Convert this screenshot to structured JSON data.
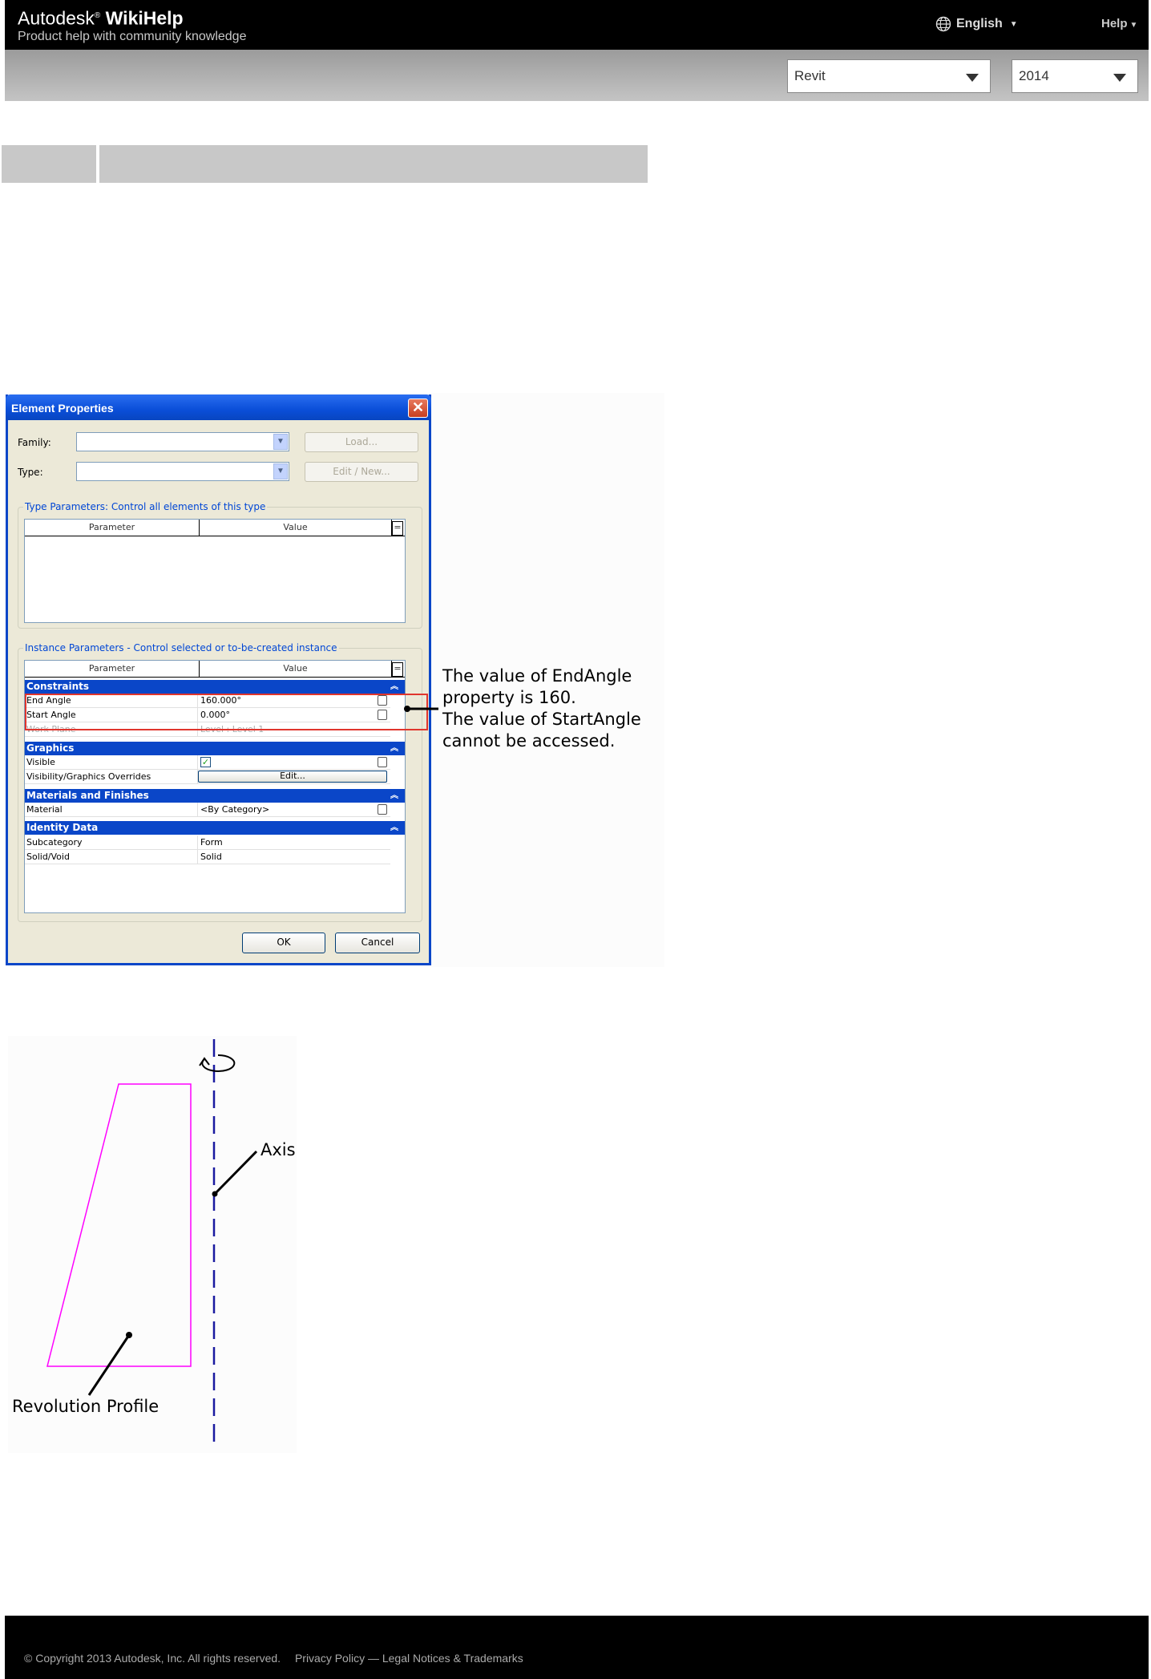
{
  "header": {
    "brand_name": "Autodesk",
    "brand_product": "WikiHelp",
    "tagline": "Product help with community knowledge",
    "language": "English",
    "help": "Help",
    "globe_icon": "globe-icon",
    "product_select": "Revit",
    "year_select": "2014"
  },
  "dialog": {
    "title": "Element Properties",
    "close_icon": "close-icon",
    "family_label": "Family:",
    "type_label": "Type:",
    "load_button": "Load...",
    "edit_new_button": "Edit / New...",
    "type_params_title": "Type Parameters: Control all elements of this type",
    "instance_params_title": "Instance Parameters - Control selected or to-be-created instance",
    "col_parameter": "Parameter",
    "col_value": "Value",
    "col_eq": "=",
    "categories": {
      "constraints": "Constraints",
      "graphics": "Graphics",
      "materials": "Materials and Finishes",
      "identity": "Identity Data"
    },
    "rows": {
      "end_angle": {
        "param": "End Angle",
        "value": "160.000°"
      },
      "start_angle": {
        "param": "Start Angle",
        "value": "0.000°"
      },
      "work_plane": {
        "param": "Work Plane",
        "value": "Level : Level 1"
      },
      "visible": {
        "param": "Visible",
        "checked": true
      },
      "vis_overrides": {
        "param": "Visibility/Graphics Overrides",
        "value": "Edit..."
      },
      "material": {
        "param": "Material",
        "value": "<By Category>"
      },
      "subcategory": {
        "param": "Subcategory",
        "value": "Form"
      },
      "solid_void": {
        "param": "Solid/Void",
        "value": "Solid"
      }
    },
    "ok_button": "OK",
    "cancel_button": "Cancel",
    "highlight_color": "#e0352d",
    "titlebar_color": "#0a4ed8"
  },
  "callout": {
    "line1": "The value of EndAngle",
    "line2": "property is 160.",
    "line3": "The value of StartAngle",
    "line4": "cannot be accessed."
  },
  "revolution_figure": {
    "axis_label": "Axis",
    "profile_label": "Revolution Profile",
    "profile_color": "#ff00ff",
    "axis_color": "#1a1aa0",
    "rotation_icon": "rotation-arrow-icon"
  },
  "footer": {
    "copyright": "© Copyright 2013 Autodesk, Inc. All rights reserved.",
    "privacy": "Privacy Policy",
    "separator": "—",
    "legal": "Legal Notices & Trademarks"
  }
}
